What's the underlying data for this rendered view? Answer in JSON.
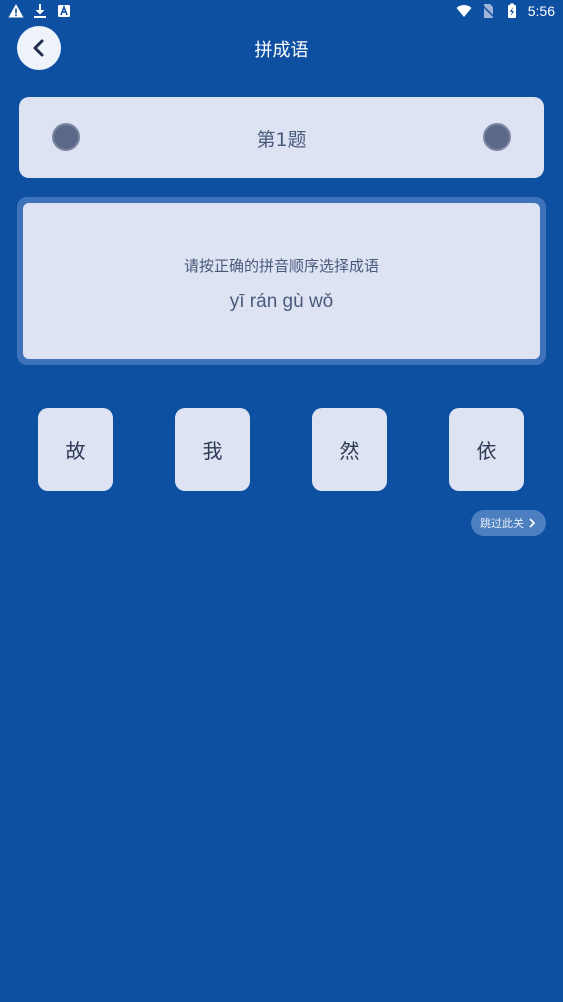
{
  "status_bar": {
    "time": "5:56",
    "left_icons": [
      "warning-icon",
      "download-icon",
      "app-icon"
    ],
    "right_icons": [
      "wifi-icon",
      "no-sim-icon",
      "battery-icon"
    ]
  },
  "header": {
    "title": "拼成语",
    "back_icon": "chevron-left-icon"
  },
  "question": {
    "number_label": "第1题"
  },
  "prompt": {
    "instruction": "请按正确的拼音顺序选择成语",
    "pinyin": "yī rán gù wǒ"
  },
  "choices": [
    {
      "char": "故"
    },
    {
      "char": "我"
    },
    {
      "char": "然"
    },
    {
      "char": "依"
    }
  ],
  "skip": {
    "label": "跳过此关",
    "icon": "chevron-right-icon"
  },
  "colors": {
    "background": "#0d4fa0",
    "card": "#dde3f3",
    "panel_border": "#3e73bb",
    "dot": "#5c6888",
    "skip_button": "#4c7fbf"
  }
}
